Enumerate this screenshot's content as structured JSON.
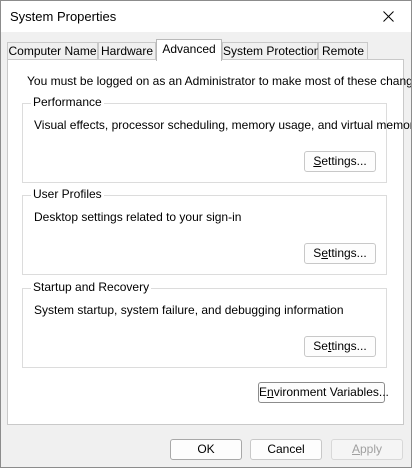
{
  "window": {
    "title": "System Properties"
  },
  "tabs": [
    {
      "label": "Computer Name",
      "active": false
    },
    {
      "label": "Hardware",
      "active": false
    },
    {
      "label": "Advanced",
      "active": true
    },
    {
      "label": "System Protection",
      "active": false
    },
    {
      "label": "Remote",
      "active": false
    }
  ],
  "advanced": {
    "admin_note": "You must be logged on as an Administrator to make most of these changes.",
    "performance": {
      "label": "Performance",
      "description": "Visual effects, processor scheduling, memory usage, and virtual memory",
      "button_pre": "",
      "button_ul": "S",
      "button_post": "ettings..."
    },
    "user_profiles": {
      "label": "User Profiles",
      "description": "Desktop settings related to your sign-in",
      "button_pre": "S",
      "button_ul": "e",
      "button_post": "ttings..."
    },
    "startup_recovery": {
      "label": "Startup and Recovery",
      "description": "System startup, system failure, and debugging information",
      "button_pre": "Se",
      "button_ul": "t",
      "button_post": "tings..."
    },
    "env_button": {
      "pre": "E",
      "ul": "n",
      "post": "vironment Variables..."
    }
  },
  "footer": {
    "ok_label": "OK",
    "cancel_label": "Cancel",
    "apply_pre": "",
    "apply_ul": "A",
    "apply_post": "pply"
  },
  "icons": {
    "close": "close-icon"
  }
}
